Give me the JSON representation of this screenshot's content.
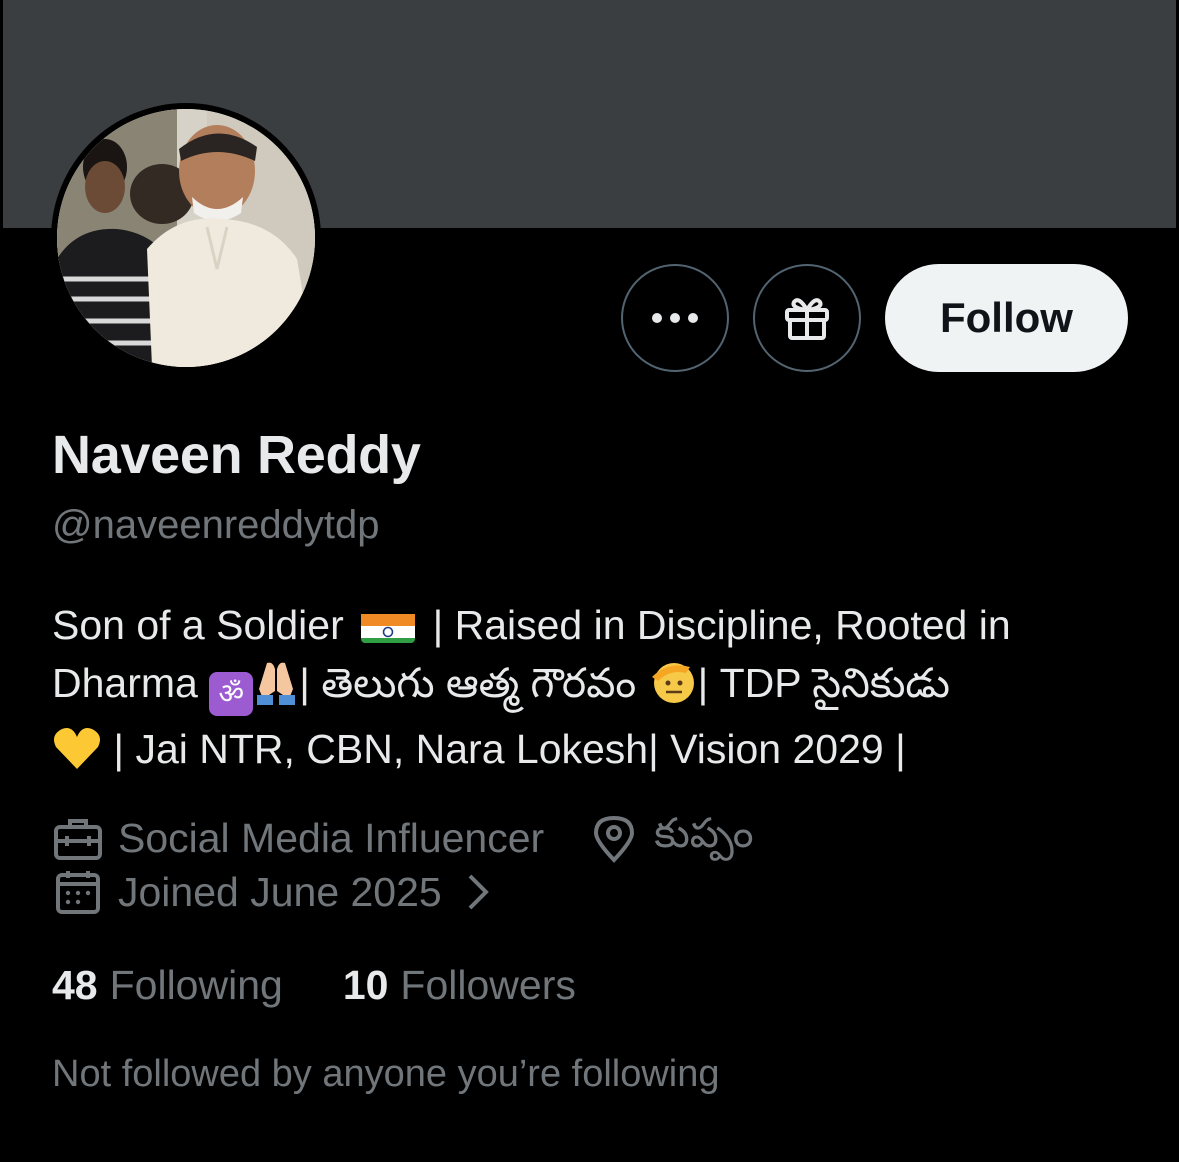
{
  "banner": {
    "color": "#3b3e41"
  },
  "actions": {
    "more_icon": "more-horizontal-icon",
    "gift_icon": "gift-icon",
    "follow_label": "Follow"
  },
  "profile": {
    "name": "Naveen Reddy",
    "handle": "@naveenreddytdp",
    "bio": {
      "line1_a": "Son of a Soldier",
      "line1_b": "| Raised in Discipline, Rooted in",
      "line2_a": "Dharma",
      "line2_b": "| తెలుగు ఆత్మ గౌరవం",
      "line2_c": "| TDP సైనికుడు",
      "line3": "| Jai NTR, CBN, Nara Lokesh| Vision 2029 |",
      "emojis": [
        "india-flag",
        "om",
        "folded-hands",
        "saluting-face",
        "yellow-heart"
      ]
    },
    "profession": "Social Media Influencer",
    "location": "కుప్పం",
    "joined": "Joined June 2025"
  },
  "stats": {
    "following_count": "48",
    "following_label": "Following",
    "followers_count": "10",
    "followers_label": "Followers"
  },
  "footer": {
    "not_followed": "Not followed by anyone you’re following"
  },
  "colors": {
    "background": "#000000",
    "primary_text": "#e7e9ea",
    "secondary_text": "#71767b",
    "follow_button_bg": "#eff3f4",
    "button_border": "#536471"
  }
}
